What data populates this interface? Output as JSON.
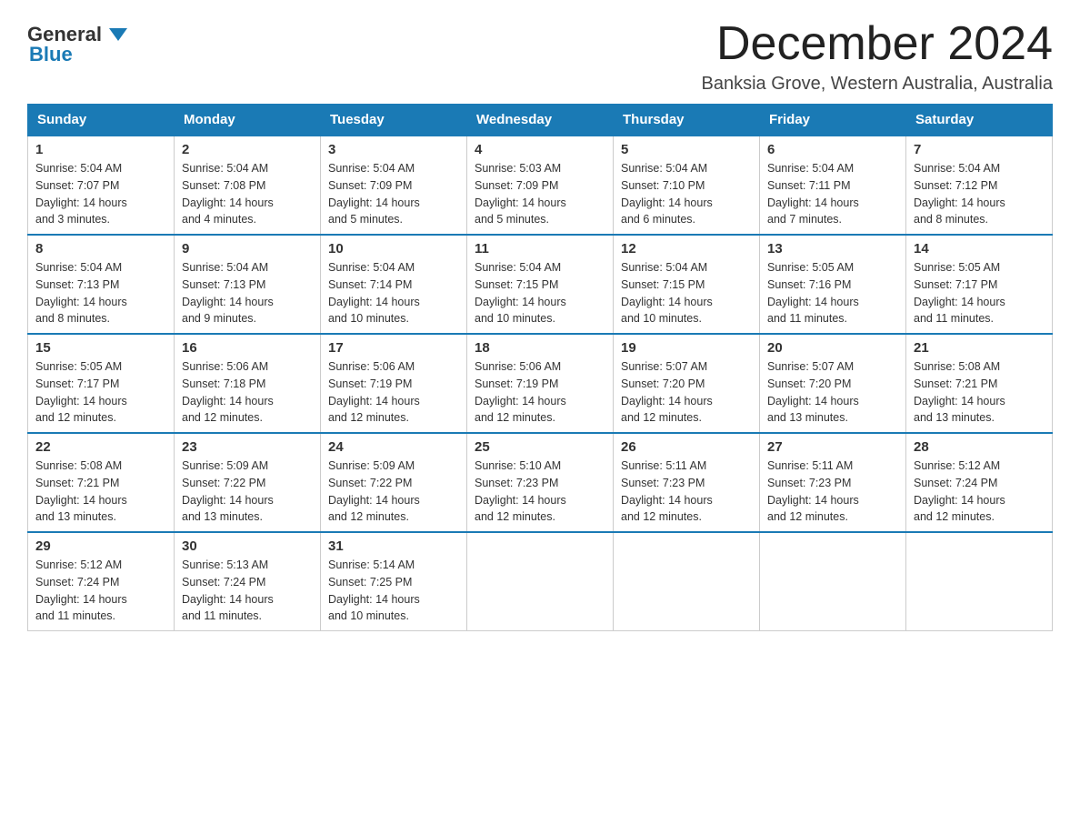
{
  "header": {
    "logo_line1": "General",
    "logo_line2": "Blue",
    "month_title": "December 2024",
    "subtitle": "Banksia Grove, Western Australia, Australia"
  },
  "days_of_week": [
    "Sunday",
    "Monday",
    "Tuesday",
    "Wednesday",
    "Thursday",
    "Friday",
    "Saturday"
  ],
  "weeks": [
    [
      {
        "num": "1",
        "sunrise": "5:04 AM",
        "sunset": "7:07 PM",
        "daylight": "14 hours and 3 minutes."
      },
      {
        "num": "2",
        "sunrise": "5:04 AM",
        "sunset": "7:08 PM",
        "daylight": "14 hours and 4 minutes."
      },
      {
        "num": "3",
        "sunrise": "5:04 AM",
        "sunset": "7:09 PM",
        "daylight": "14 hours and 5 minutes."
      },
      {
        "num": "4",
        "sunrise": "5:03 AM",
        "sunset": "7:09 PM",
        "daylight": "14 hours and 5 minutes."
      },
      {
        "num": "5",
        "sunrise": "5:04 AM",
        "sunset": "7:10 PM",
        "daylight": "14 hours and 6 minutes."
      },
      {
        "num": "6",
        "sunrise": "5:04 AM",
        "sunset": "7:11 PM",
        "daylight": "14 hours and 7 minutes."
      },
      {
        "num": "7",
        "sunrise": "5:04 AM",
        "sunset": "7:12 PM",
        "daylight": "14 hours and 8 minutes."
      }
    ],
    [
      {
        "num": "8",
        "sunrise": "5:04 AM",
        "sunset": "7:13 PM",
        "daylight": "14 hours and 8 minutes."
      },
      {
        "num": "9",
        "sunrise": "5:04 AM",
        "sunset": "7:13 PM",
        "daylight": "14 hours and 9 minutes."
      },
      {
        "num": "10",
        "sunrise": "5:04 AM",
        "sunset": "7:14 PM",
        "daylight": "14 hours and 10 minutes."
      },
      {
        "num": "11",
        "sunrise": "5:04 AM",
        "sunset": "7:15 PM",
        "daylight": "14 hours and 10 minutes."
      },
      {
        "num": "12",
        "sunrise": "5:04 AM",
        "sunset": "7:15 PM",
        "daylight": "14 hours and 10 minutes."
      },
      {
        "num": "13",
        "sunrise": "5:05 AM",
        "sunset": "7:16 PM",
        "daylight": "14 hours and 11 minutes."
      },
      {
        "num": "14",
        "sunrise": "5:05 AM",
        "sunset": "7:17 PM",
        "daylight": "14 hours and 11 minutes."
      }
    ],
    [
      {
        "num": "15",
        "sunrise": "5:05 AM",
        "sunset": "7:17 PM",
        "daylight": "14 hours and 12 minutes."
      },
      {
        "num": "16",
        "sunrise": "5:06 AM",
        "sunset": "7:18 PM",
        "daylight": "14 hours and 12 minutes."
      },
      {
        "num": "17",
        "sunrise": "5:06 AM",
        "sunset": "7:19 PM",
        "daylight": "14 hours and 12 minutes."
      },
      {
        "num": "18",
        "sunrise": "5:06 AM",
        "sunset": "7:19 PM",
        "daylight": "14 hours and 12 minutes."
      },
      {
        "num": "19",
        "sunrise": "5:07 AM",
        "sunset": "7:20 PM",
        "daylight": "14 hours and 12 minutes."
      },
      {
        "num": "20",
        "sunrise": "5:07 AM",
        "sunset": "7:20 PM",
        "daylight": "14 hours and 13 minutes."
      },
      {
        "num": "21",
        "sunrise": "5:08 AM",
        "sunset": "7:21 PM",
        "daylight": "14 hours and 13 minutes."
      }
    ],
    [
      {
        "num": "22",
        "sunrise": "5:08 AM",
        "sunset": "7:21 PM",
        "daylight": "14 hours and 13 minutes."
      },
      {
        "num": "23",
        "sunrise": "5:09 AM",
        "sunset": "7:22 PM",
        "daylight": "14 hours and 13 minutes."
      },
      {
        "num": "24",
        "sunrise": "5:09 AM",
        "sunset": "7:22 PM",
        "daylight": "14 hours and 12 minutes."
      },
      {
        "num": "25",
        "sunrise": "5:10 AM",
        "sunset": "7:23 PM",
        "daylight": "14 hours and 12 minutes."
      },
      {
        "num": "26",
        "sunrise": "5:11 AM",
        "sunset": "7:23 PM",
        "daylight": "14 hours and 12 minutes."
      },
      {
        "num": "27",
        "sunrise": "5:11 AM",
        "sunset": "7:23 PM",
        "daylight": "14 hours and 12 minutes."
      },
      {
        "num": "28",
        "sunrise": "5:12 AM",
        "sunset": "7:24 PM",
        "daylight": "14 hours and 12 minutes."
      }
    ],
    [
      {
        "num": "29",
        "sunrise": "5:12 AM",
        "sunset": "7:24 PM",
        "daylight": "14 hours and 11 minutes."
      },
      {
        "num": "30",
        "sunrise": "5:13 AM",
        "sunset": "7:24 PM",
        "daylight": "14 hours and 11 minutes."
      },
      {
        "num": "31",
        "sunrise": "5:14 AM",
        "sunset": "7:25 PM",
        "daylight": "14 hours and 10 minutes."
      },
      null,
      null,
      null,
      null
    ]
  ],
  "labels": {
    "sunrise": "Sunrise:",
    "sunset": "Sunset:",
    "daylight": "Daylight:"
  }
}
